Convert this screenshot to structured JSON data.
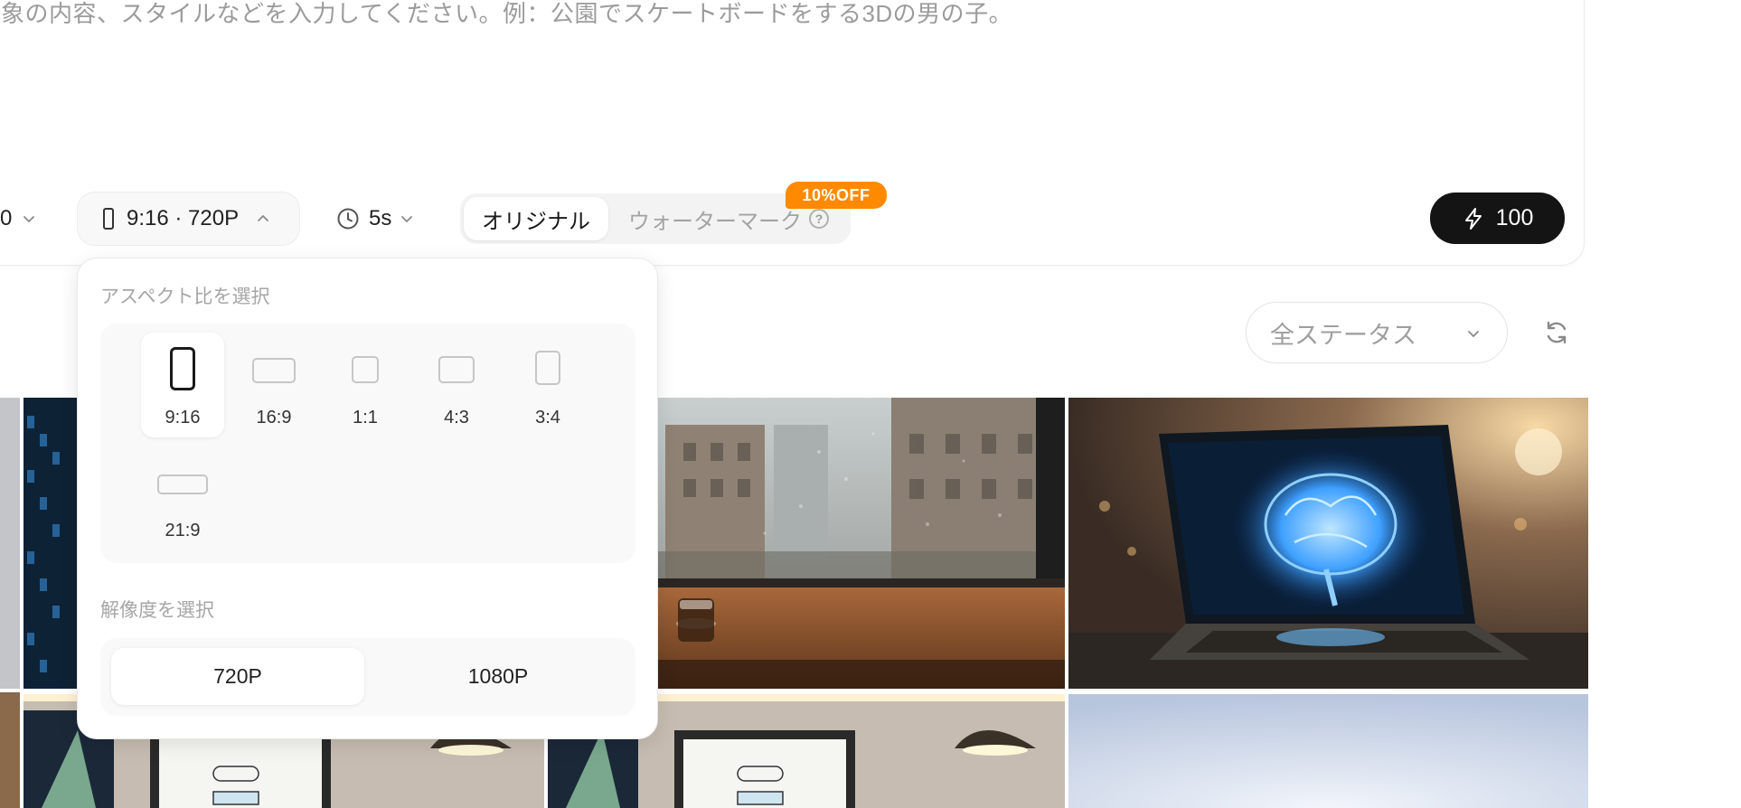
{
  "prompt": {
    "placeholder": "象の内容、スタイルなどを入力してください。例：公園でスケートボードをする3Dの男の子。"
  },
  "toolbar": {
    "model_value": "0",
    "aspect_value": "9:16 · 720P",
    "duration_value": "5s",
    "watermark": {
      "option_original": "オリジナル",
      "option_watermark": "ウォーターマーク",
      "help_glyph": "?",
      "discount_badge": "10%OFF",
      "badge_color": "#ff8a00"
    },
    "generate": {
      "credits": "100"
    }
  },
  "aspect_popover": {
    "ratio_title": "アスペクト比を選択",
    "ratios": [
      {
        "label": "9:16",
        "selected": true
      },
      {
        "label": "16:9",
        "selected": false
      },
      {
        "label": "1:1",
        "selected": false
      },
      {
        "label": "4:3",
        "selected": false
      },
      {
        "label": "3:4",
        "selected": false
      },
      {
        "label": "21:9",
        "selected": false
      }
    ],
    "resolution_title": "解像度を選択",
    "resolutions": [
      {
        "label": "720P",
        "selected": true
      },
      {
        "label": "1080P",
        "selected": false
      }
    ]
  },
  "filters": {
    "status_value": "全ステータス"
  },
  "icons": {
    "chevron": "chevron-down-icon",
    "phone": "phone-portrait-icon",
    "clock": "clock-icon",
    "bolt": "lightning-bolt-icon",
    "refresh": "refresh-icon"
  },
  "gallery": [
    {
      "subject": "cafe-rain-window"
    },
    {
      "subject": "laptop-glowing-brain"
    },
    {
      "subject": "server-rack-city"
    },
    {
      "subject": "algorithm-flowchart-poster"
    },
    {
      "subject": "algorithm-flowchart-poster"
    },
    {
      "subject": "pale-blue-sky"
    }
  ]
}
